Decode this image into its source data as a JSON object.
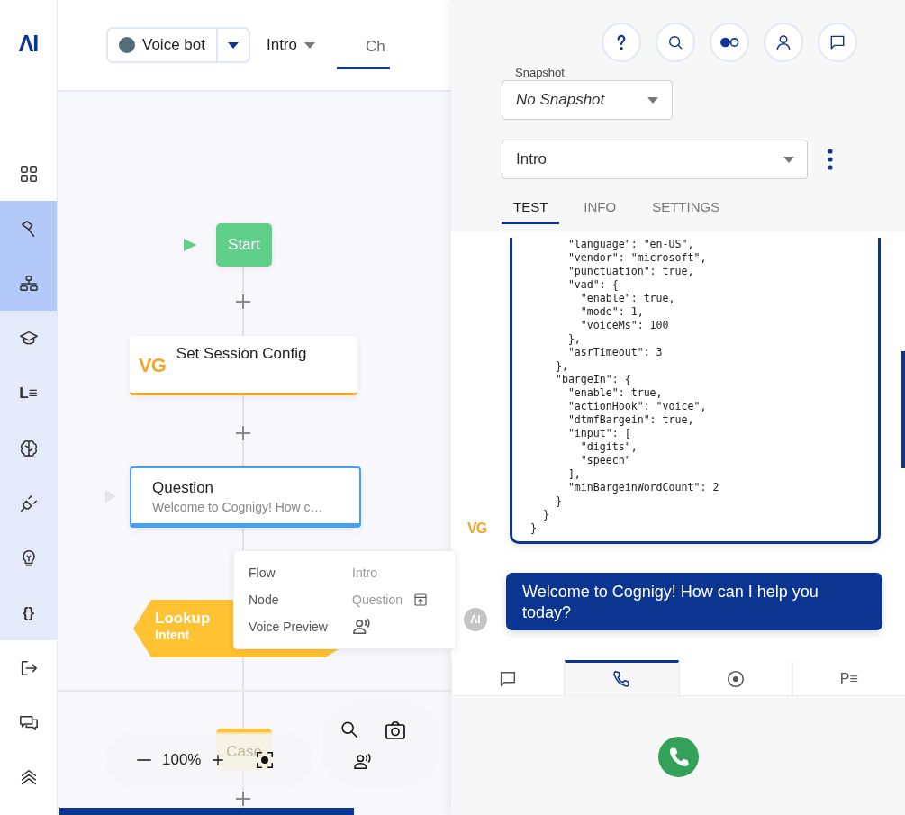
{
  "sidebar": {
    "logo": "ΛI",
    "sections": [
      {
        "items": [
          {
            "kind": "dashboard",
            "selected": false
          }
        ]
      },
      {
        "expanded": true,
        "items": [
          {
            "kind": "build",
            "selected": true
          },
          {
            "kind": "flow",
            "selected": true
          },
          {
            "kind": "train",
            "selected": false
          },
          {
            "kind": "lexicon",
            "glyph": "L≡",
            "selected": false
          },
          {
            "kind": "brain",
            "selected": false
          },
          {
            "kind": "plug",
            "selected": false
          },
          {
            "kind": "bulb",
            "selected": false
          },
          {
            "kind": "code",
            "glyph": "{}",
            "selected": false
          }
        ]
      },
      {
        "items": [
          {
            "kind": "exit",
            "selected": false
          },
          {
            "kind": "chat",
            "selected": false
          },
          {
            "kind": "layers",
            "selected": false
          }
        ]
      }
    ]
  },
  "header": {
    "bot": {
      "label": "Voice bot"
    },
    "flow": {
      "label": "Intro"
    },
    "tabs": [
      {
        "label": "Ch",
        "selected": true
      }
    ]
  },
  "canvas": {
    "nodes": [
      {
        "kind": "start",
        "label": "Start"
      },
      {
        "kind": "code",
        "badge": "VG",
        "label": "Set Session Config"
      },
      {
        "kind": "question",
        "label": "Question",
        "subtitle": "Welcome to Cognigy! How c…",
        "selected": true
      },
      {
        "kind": "lookup",
        "label": "Lookup",
        "subtitle": "Intent"
      },
      {
        "kind": "case",
        "label": "Case"
      }
    ],
    "zoom": "100%"
  },
  "tooltip": {
    "rows": [
      {
        "kind": "text",
        "label": "Flow",
        "value": "Intro"
      },
      {
        "kind": "link",
        "label": "Node",
        "value": "Question"
      },
      {
        "kind": "voice",
        "label": "Voice Preview"
      }
    ]
  },
  "panel": {
    "snapshot": {
      "label": "Snapshot",
      "value": "No Snapshot"
    },
    "flow": {
      "value": "Intro"
    },
    "tabs": [
      {
        "label": "TEST",
        "selected": true
      },
      {
        "label": "INFO",
        "selected": false
      },
      {
        "label": "SETTINGS",
        "selected": false
      }
    ],
    "messages": [
      {
        "kind": "code",
        "sender": "VG",
        "lines": [
          "      \"language\": \"en-US\",",
          "      \"vendor\": \"microsoft\",",
          "      \"punctuation\": true,",
          "      \"vad\": {",
          "        \"enable\": true,",
          "        \"mode\": 1,",
          "        \"voiceMs\": 100",
          "      },",
          "      \"asrTimeout\": 3",
          "    },",
          "    \"bargeIn\": {",
          "      \"enable\": true,",
          "      \"actionHook\": \"voice\",",
          "      \"dtmfBargein\": true,",
          "      \"input\": [",
          "        \"digits\",",
          "        \"speech\"",
          "      ],",
          "      \"minBargeinWordCount\": 2",
          "    }",
          "  }",
          "}"
        ]
      },
      {
        "kind": "text",
        "avatar": "ΛI",
        "text": "Welcome to Cognigy! How can I help you today?"
      }
    ],
    "mode_tabs": [
      {
        "kind": "chat",
        "selected": false
      },
      {
        "kind": "phone",
        "selected": true
      },
      {
        "kind": "record",
        "selected": false
      },
      {
        "kind": "playbook",
        "glyph": "P≡",
        "selected": false
      }
    ]
  }
}
